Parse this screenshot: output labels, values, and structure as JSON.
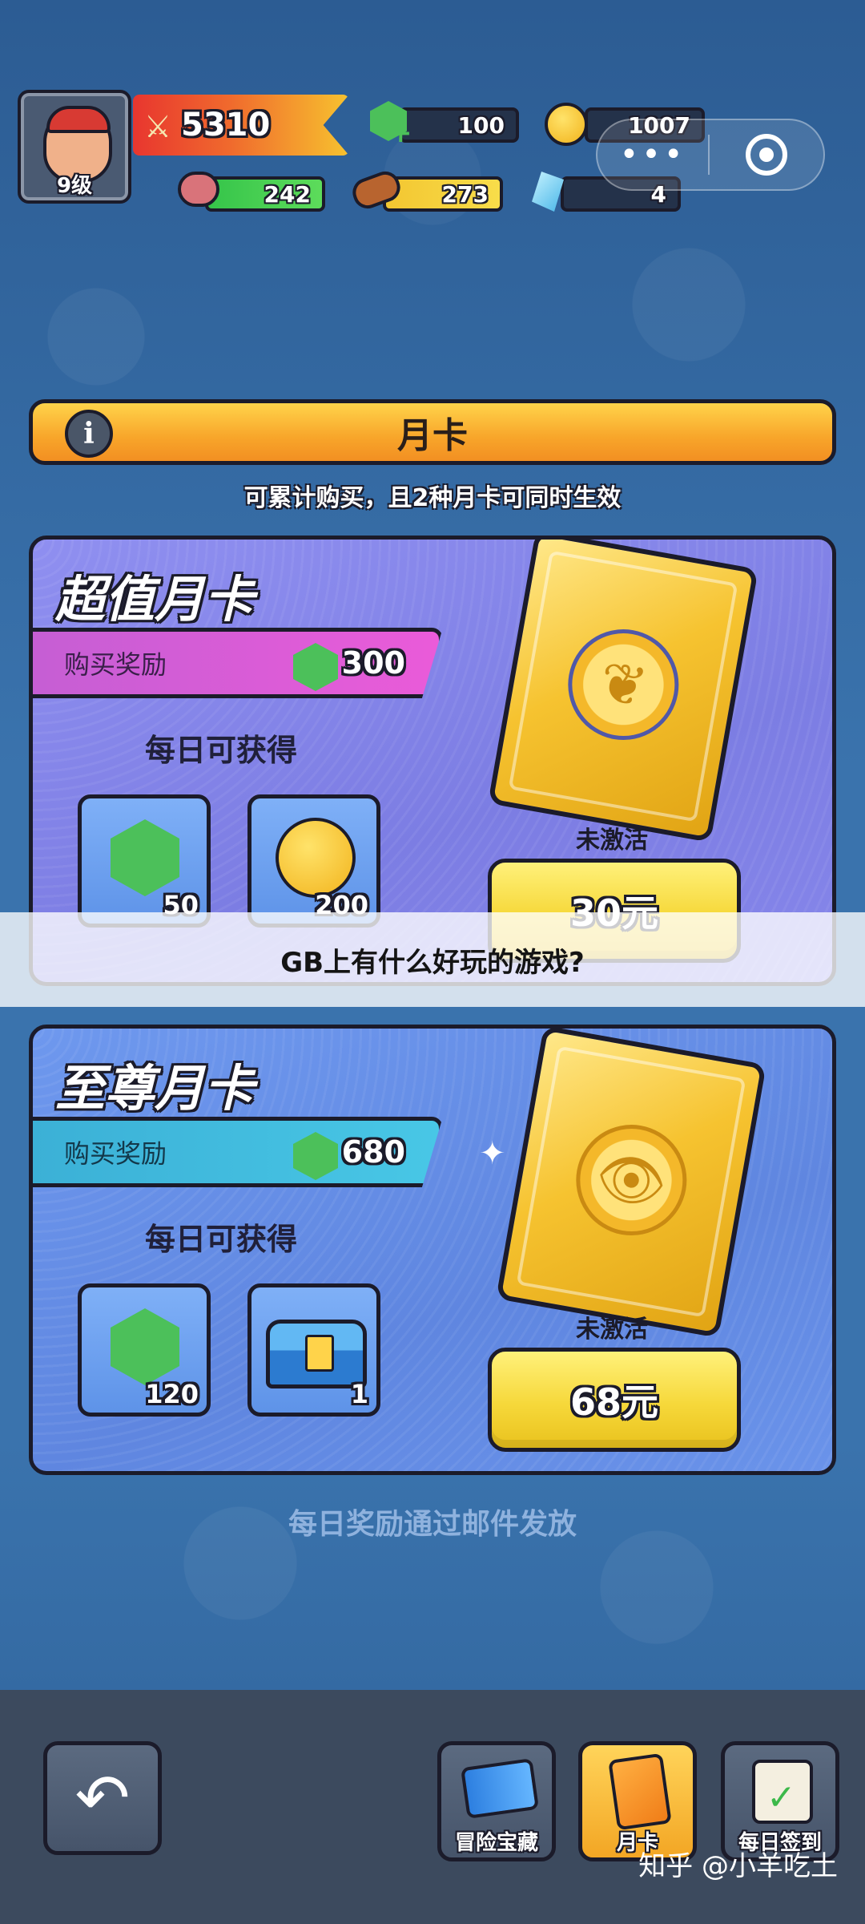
{
  "hud": {
    "level": "9级",
    "power": "5310",
    "gems": "100",
    "coins": "1007",
    "meat": "242",
    "wood": "273",
    "crystals": "4"
  },
  "capsule": {
    "menu_glyph": "•••",
    "close_glyph": "◎"
  },
  "header": {
    "info_glyph": "i",
    "title": "月卡",
    "subtitle": "可累计购买，且2种月卡可同时生效"
  },
  "cards": [
    {
      "title": "超值月卡",
      "reward_label": "购买奖励",
      "reward_amount": "300",
      "daily_label": "每日可获得",
      "items": [
        {
          "icon": "gem-icon",
          "count": "50"
        },
        {
          "icon": "coin-icon",
          "count": "200"
        }
      ],
      "status": "未激活",
      "price": "30元"
    },
    {
      "title": "至尊月卡",
      "reward_label": "购买奖励",
      "reward_amount": "680",
      "daily_label": "每日可获得",
      "items": [
        {
          "icon": "gem-icon",
          "count": "120"
        },
        {
          "icon": "chest-icon",
          "count": "1"
        }
      ],
      "status": "未激活",
      "price": "68元"
    }
  ],
  "overlay": {
    "question": "GB上有什么好玩的游戏?"
  },
  "footer_note": "每日奖励通过邮件发放",
  "bottom_nav": {
    "back_glyph": "↶",
    "items": [
      {
        "label": "冒险宝藏",
        "icon": "ticket-icon"
      },
      {
        "label": "月卡",
        "icon": "month-card-icon",
        "active": true
      },
      {
        "label": "每日签到",
        "icon": "calendar-check-icon"
      }
    ]
  },
  "watermark": "知乎 @小羊吃土",
  "colors": {
    "accent_orange": "#f8a52a",
    "card_purple": "#7c7de3",
    "card_blue": "#5f86e0",
    "price_yellow": "#f6d83a",
    "gem_green": "#4cc05a"
  }
}
